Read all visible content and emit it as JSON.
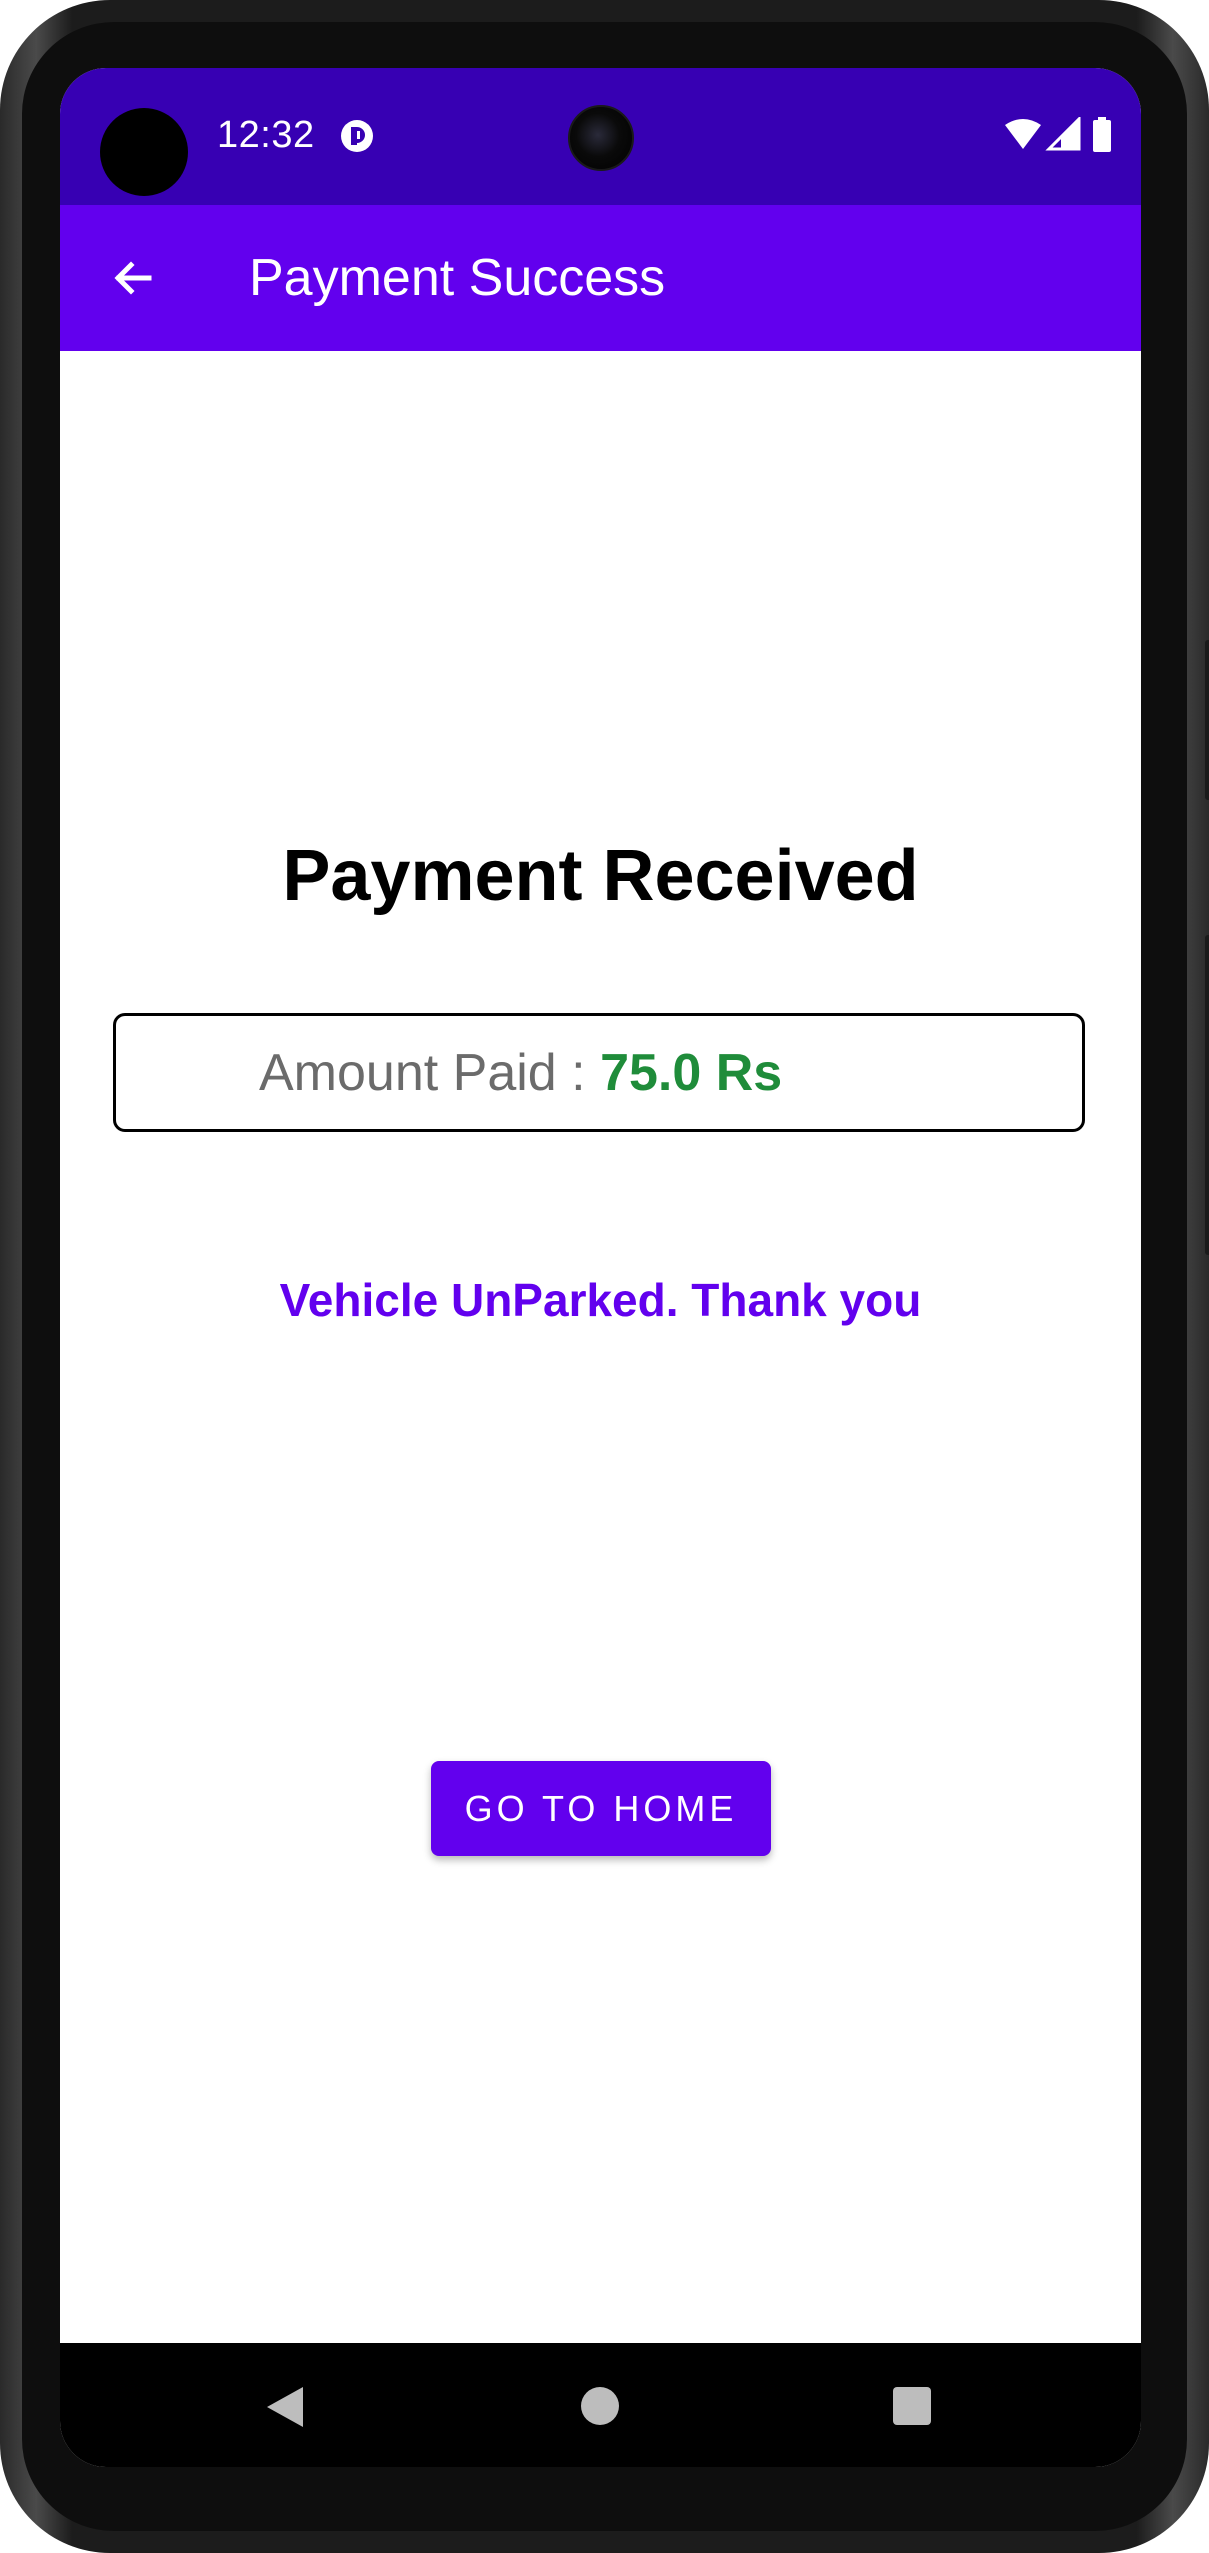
{
  "status_bar": {
    "time": "12:32",
    "background_color": "#3700b3",
    "icons": [
      "notification-icon",
      "wifi-icon",
      "cellular-signal-icon",
      "battery-icon"
    ]
  },
  "app_bar": {
    "title": "Payment Success",
    "back_icon": "arrow-back-icon",
    "background_color": "#6200ee"
  },
  "content": {
    "heading": "Payment Received",
    "amount_label": "Amount Paid : ",
    "amount_value": "75.0 Rs",
    "amount_value_color": "#1f8c3a",
    "message": "Vehicle UnParked. Thank you",
    "message_color": "#6200ee",
    "home_button_label": "GO TO HOME"
  },
  "nav_bar": {
    "icons": [
      "nav-back-icon",
      "nav-home-icon",
      "nav-recents-icon"
    ]
  }
}
